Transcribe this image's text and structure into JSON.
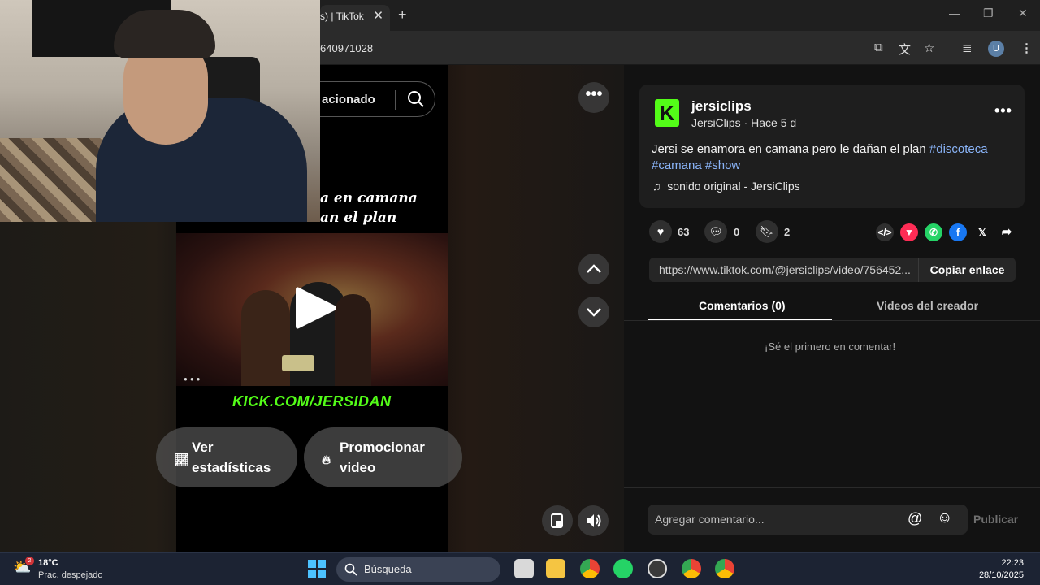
{
  "browser": {
    "tab_title": "s) | TikTok",
    "url_fragment": "640971028",
    "profile_initial": "U"
  },
  "video": {
    "search_text": "acionado",
    "caption_lines": [
      "a en camana",
      "an el plan"
    ],
    "overlay_text": "KICK.COM/JERSIDAN",
    "stats_button": "Ver estadísticas",
    "stats_line1": "Ver",
    "stats_line2": "estadísticas",
    "promote_line1": "Promocionar",
    "promote_line2": "video"
  },
  "post": {
    "username": "jersiclips",
    "display_name": "JersiClips",
    "posted": "Hace 5 d",
    "user_line": "JersiClips · Hace 5 d",
    "description": "Jersi se enamora en camana pero le dañan el plan ",
    "hashtags": [
      "#discoteca",
      "#camana",
      "#show"
    ],
    "sound": "sonido original - JersiClips",
    "likes": "63",
    "comments": "0",
    "saves": "2",
    "link": "https://www.tiktok.com/@jersiclips/video/756452...",
    "copy_link": "Copiar enlace",
    "tab_comments": "Comentarios (0)",
    "tab_creator": "Videos del creador",
    "empty_comments": "¡Sé el primero en comentar!",
    "comment_placeholder": "Agregar comentario...",
    "publish": "Publicar"
  },
  "taskbar": {
    "temperature": "18°C",
    "weather": "Prac. despejado",
    "weather_badge": "2",
    "search_label": "Búsqueda",
    "time": "22:23",
    "date": "28/10/2025"
  },
  "colors": {
    "kick_green": "#53fc18",
    "hashtag_blue": "#8ab4f8",
    "panel_bg": "#121212"
  }
}
